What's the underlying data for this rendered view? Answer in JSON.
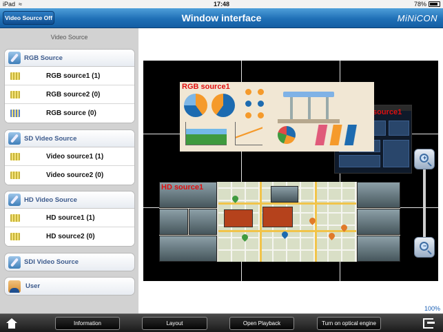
{
  "status": {
    "carrier": "iPad",
    "time": "17:48",
    "battery": "78%"
  },
  "header": {
    "title": "Window interface",
    "video_source_off": "Video Source Off",
    "logo": "MiNiCON"
  },
  "sidebar": {
    "heading": "Video Source",
    "groups": [
      {
        "label": "RGB Source",
        "items": [
          "RGB source1 (1)",
          "RGB source2 (0)",
          "RGB source (0)"
        ]
      },
      {
        "label": "SD Video Source",
        "items": [
          "Video source1 (1)",
          "Video source2 (0)"
        ]
      },
      {
        "label": "HD Video Source",
        "items": [
          "HD source1 (1)",
          "HD source2 (0)"
        ]
      },
      {
        "label": "SDI Video Source",
        "items": []
      },
      {
        "label": "User",
        "items": []
      }
    ]
  },
  "wall": {
    "windows": [
      {
        "title": "RGB source1"
      },
      {
        "title": "source1"
      },
      {
        "title": "HD source1"
      }
    ],
    "zoom_level": "100%"
  },
  "toolbar": {
    "information": "Information",
    "layout": "Layout",
    "open_playback": "Open Playback",
    "optical_engine": "Turn on optical engine"
  },
  "icons": [
    "home-icon",
    "exit-icon",
    "zoom-in-icon",
    "zoom-out-icon",
    "wifi-icon",
    "battery-icon"
  ]
}
